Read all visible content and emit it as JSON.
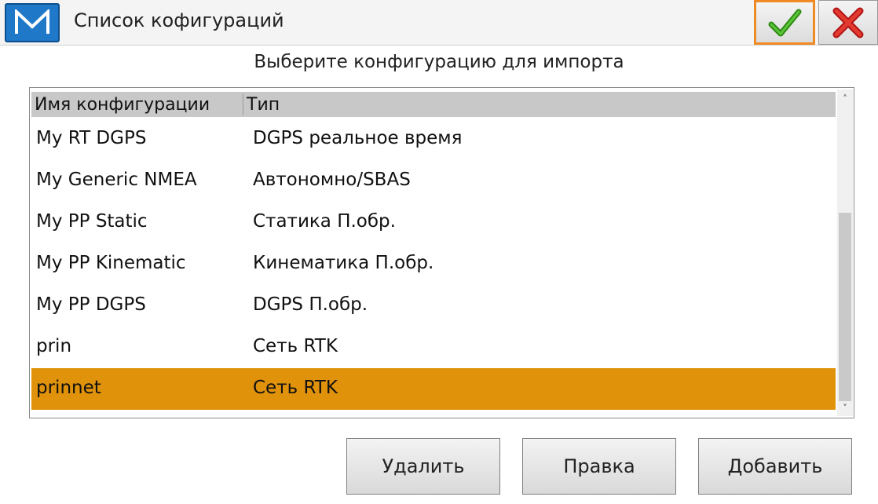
{
  "window": {
    "title": "Список кофигураций",
    "logo_icon": "m-logo-icon",
    "ok_icon": "checkmark-icon",
    "close_icon": "close-x-icon",
    "accent_color": "#f08a24"
  },
  "prompt": "Выберите конфигурацию для импорта",
  "table": {
    "columns": [
      "Имя конфигурации",
      "Тип"
    ],
    "rows": [
      {
        "name": "My RT DGPS",
        "type": "DGPS реальное время"
      },
      {
        "name": "My Generic NMEA",
        "type": "Автономно/SBAS"
      },
      {
        "name": "My PP Static",
        "type": "Статика П.обр."
      },
      {
        "name": "My PP Kinematic",
        "type": "Кинематика П.обр."
      },
      {
        "name": "My PP DGPS",
        "type": "DGPS П.обр."
      },
      {
        "name": "prin",
        "type": "Сеть RTK"
      },
      {
        "name": "prinnet",
        "type": "Сеть RTK"
      }
    ],
    "selected_index": 6,
    "selected_color": "#e0920a"
  },
  "scrollbar": {
    "up_glyph": "˄",
    "down_glyph": "˅"
  },
  "buttons": {
    "delete": "Удалить",
    "edit": "Правка",
    "add": "Добавить"
  }
}
